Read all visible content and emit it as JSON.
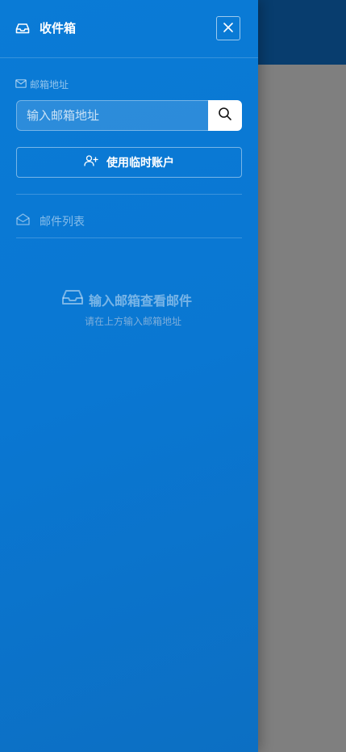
{
  "drawer": {
    "title": "收件箱",
    "title_icon": "inbox-icon",
    "close_icon": "close-icon"
  },
  "email_section": {
    "label": "邮箱地址",
    "label_icon": "envelope-icon",
    "input_value": "",
    "input_placeholder": "输入邮箱地址",
    "search_icon": "search-icon"
  },
  "temp_account_button": {
    "label": "使用临时账户",
    "icon": "user-plus-icon"
  },
  "mail_list": {
    "header": "邮件列表",
    "header_icon": "envelope-open-icon"
  },
  "empty_state": {
    "title": "输入邮箱查看邮件",
    "subtitle": "请在上方输入邮箱地址",
    "icon": "inbox-icon"
  },
  "colors": {
    "drawer_bg": "#0a7bd6",
    "backdrop": "#7f7f7f",
    "app_header": "#083d6e"
  }
}
